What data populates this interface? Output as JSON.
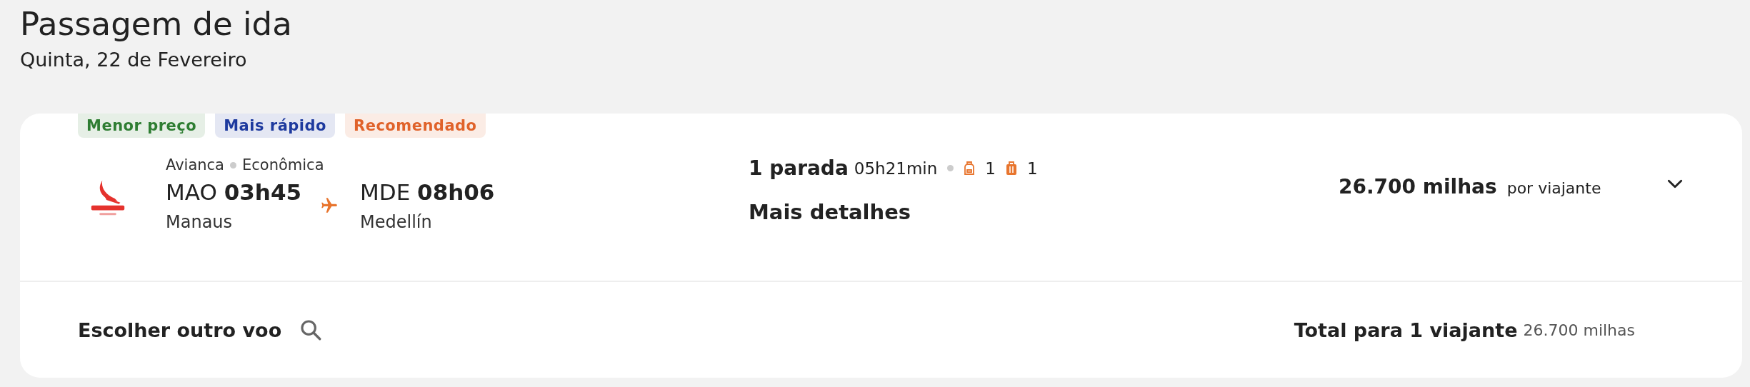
{
  "header": {
    "title": "Passagem de ida",
    "date": "Quinta, 22 de Fevereiro"
  },
  "badges": [
    {
      "label": "Menor preço",
      "color": "#2e7d32"
    },
    {
      "label": "Mais rápido",
      "color": "#1e3a9e"
    },
    {
      "label": "Recomendado",
      "color": "#e0622a"
    }
  ],
  "flight": {
    "airline": "Avianca",
    "cabin": "Econômica",
    "origin": {
      "code": "MAO",
      "time": "03h45",
      "city": "Manaus"
    },
    "destination": {
      "code": "MDE",
      "time": "08h06",
      "city": "Medellín"
    },
    "stops": "1 parada",
    "duration": "05h21min",
    "backpack": "1",
    "suitcase": "1",
    "details_link": "Mais detalhes",
    "price": "26.700 milhas",
    "price_note": "por viajante",
    "expanded": false
  },
  "footer": {
    "change_link": "Escolher outro voo",
    "total_label": "Total para 1 viajante",
    "total_value": "26.700 milhas"
  }
}
